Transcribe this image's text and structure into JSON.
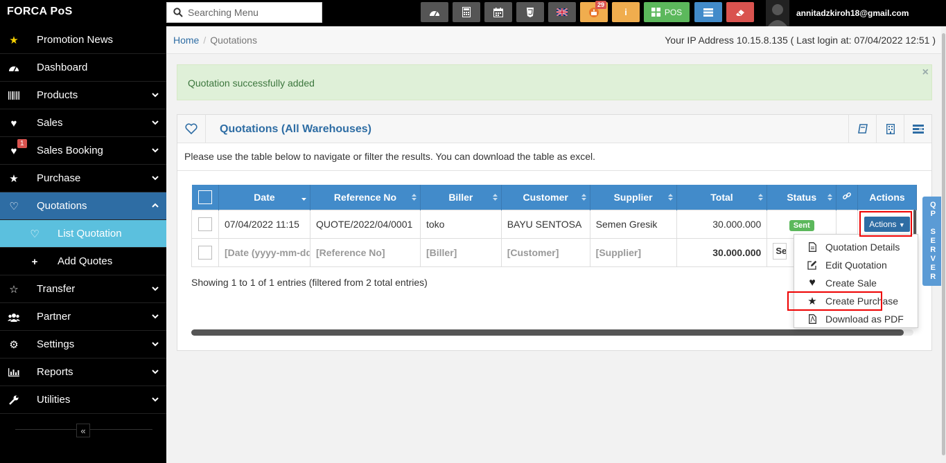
{
  "app": {
    "brand": "FORCA PoS"
  },
  "search": {
    "placeholder": "Searching Menu"
  },
  "toolbar": {
    "notification_count": "29",
    "pos_label": "POS",
    "colors": {
      "dark": "#555555",
      "orange": "#f0ad4e",
      "yellow": "#f0ad4e",
      "green": "#5cb85c",
      "blue": "#428bca",
      "red": "#d9534f"
    }
  },
  "user": {
    "email": "annitadzkiroh18@gmail.com"
  },
  "sidebar": {
    "items": [
      {
        "label": "Promotion News",
        "icon": "star-icon"
      },
      {
        "label": "Dashboard",
        "icon": "dashboard-icon"
      },
      {
        "label": "Products",
        "icon": "barcode-icon"
      },
      {
        "label": "Sales",
        "icon": "heart-icon"
      },
      {
        "label": "Sales Booking",
        "icon": "heart-icon",
        "badge": "1"
      },
      {
        "label": "Purchase",
        "icon": "star-icon"
      },
      {
        "label": "Quotations",
        "icon": "heart-outline-icon"
      },
      {
        "label": "List Quotation",
        "icon": "heart-outline-icon"
      },
      {
        "label": "Add Quotes",
        "icon": "plus-icon"
      },
      {
        "label": "Transfer",
        "icon": "star-outline-icon"
      },
      {
        "label": "Partner",
        "icon": "users-icon"
      },
      {
        "label": "Settings",
        "icon": "gear-icon"
      },
      {
        "label": "Reports",
        "icon": "bar-chart-icon"
      },
      {
        "label": "Utilities",
        "icon": "wrench-icon"
      }
    ],
    "collapse": "«"
  },
  "breadcrumb": {
    "home": "Home",
    "current": "Quotations"
  },
  "ip_info": "Your IP Address 10.15.8.135 ( Last login at: 07/04/2022 12:51 )",
  "alert": {
    "message": "Quotation successfully added",
    "close": "×"
  },
  "panel": {
    "title": "Quotations (All Warehouses)",
    "intro": "Please use the table below to navigate or filter the results. You can download the table as excel."
  },
  "table": {
    "columns": [
      "Date",
      "Reference No",
      "Biller",
      "Customer",
      "Supplier",
      "Total",
      "Status",
      "Actions"
    ],
    "rows": [
      {
        "date": "07/04/2022 11:15",
        "reference": "QUOTE/2022/04/0001",
        "biller": "toko",
        "customer": "BAYU SENTOSA",
        "supplier": "Semen Gresik",
        "total": "30.000.000",
        "status": "Sent",
        "action": "Actions"
      }
    ],
    "filters": {
      "date": "[Date (yyyy-mm-dd)]",
      "reference": "[Reference No]",
      "biller": "[Biller]",
      "customer": "[Customer]",
      "supplier": "[Supplier]",
      "total": "30.000.000",
      "status": "Se"
    },
    "info": "Showing 1 to 1 of 1 entries (filtered from 2 total entries)"
  },
  "actions_menu": {
    "items": [
      {
        "label": "Quotation Details",
        "icon": "file-icon"
      },
      {
        "label": "Edit Quotation",
        "icon": "edit-icon"
      },
      {
        "label": "Create Sale",
        "icon": "heart-icon"
      },
      {
        "label": "Create Purchase",
        "icon": "star-icon"
      },
      {
        "label": "Download as PDF",
        "icon": "pdf-icon"
      }
    ]
  },
  "side_tab": {
    "label": "QP SERVER"
  }
}
